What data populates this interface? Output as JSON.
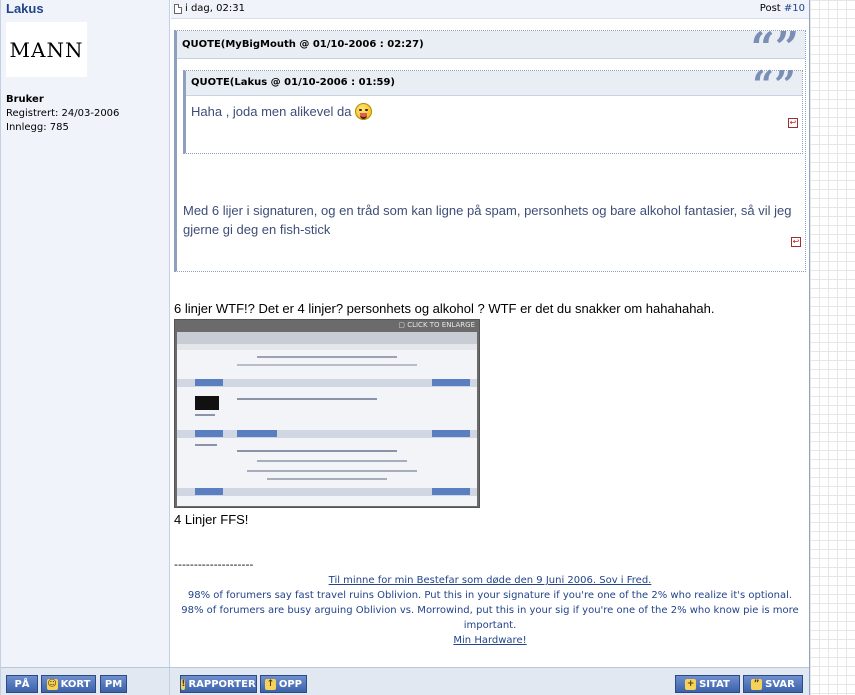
{
  "author": {
    "name": "Lakus",
    "avatar_text": "MANN",
    "rank": "Bruker",
    "registered": "Registrert: 24/03-2006",
    "posts": "Innlegg: 785"
  },
  "post": {
    "date": "i dag, 02:31",
    "number_prefix": "Post ",
    "number_link": "#10"
  },
  "outer_quote": {
    "title": "QUOTE(MyBigMouth @ 01/10-2006 : 02:27)",
    "text": "Med 6 lijer i signaturen, og en tråd som kan ligne på spam, personhets og bare alkohol fantasier, så vil jeg gjerne gi deg en fish-stick"
  },
  "inner_quote": {
    "title": "QUOTE(Lakus @ 01/10-2006 : 01:59)",
    "text": "Haha , joda men alikevel da"
  },
  "body": {
    "line1": "6 linjer WTF!? Det er 4 linjer? personhets og alkohol ? WTF er det du snakker om hahahahah.",
    "thumb_caption": "CLICK TO ENLARGE",
    "line2": "4 Linjer FFS!"
  },
  "signature": {
    "separator": "--------------------",
    "link1": "Til minne for min Bestefar som døde den 9 Juni 2006. Sov i Fred.",
    "line2": "98% of forumers say fast travel ruins Oblivion. Put this in your signature if you're one of the 2% who realize it's optional.",
    "line3": "98% of forumers are busy arguing Oblivion vs. Morrowind, put this in your sig if you're one of the 2% who know pie is more important.",
    "link2": "Min Hardware!"
  },
  "buttons": {
    "pa": "PÅ",
    "kort": "KORT",
    "pm": "PM",
    "rapporter": "RAPPORTER",
    "opp": "OPP",
    "sitat": "SITAT",
    "svar": "SVAR"
  }
}
